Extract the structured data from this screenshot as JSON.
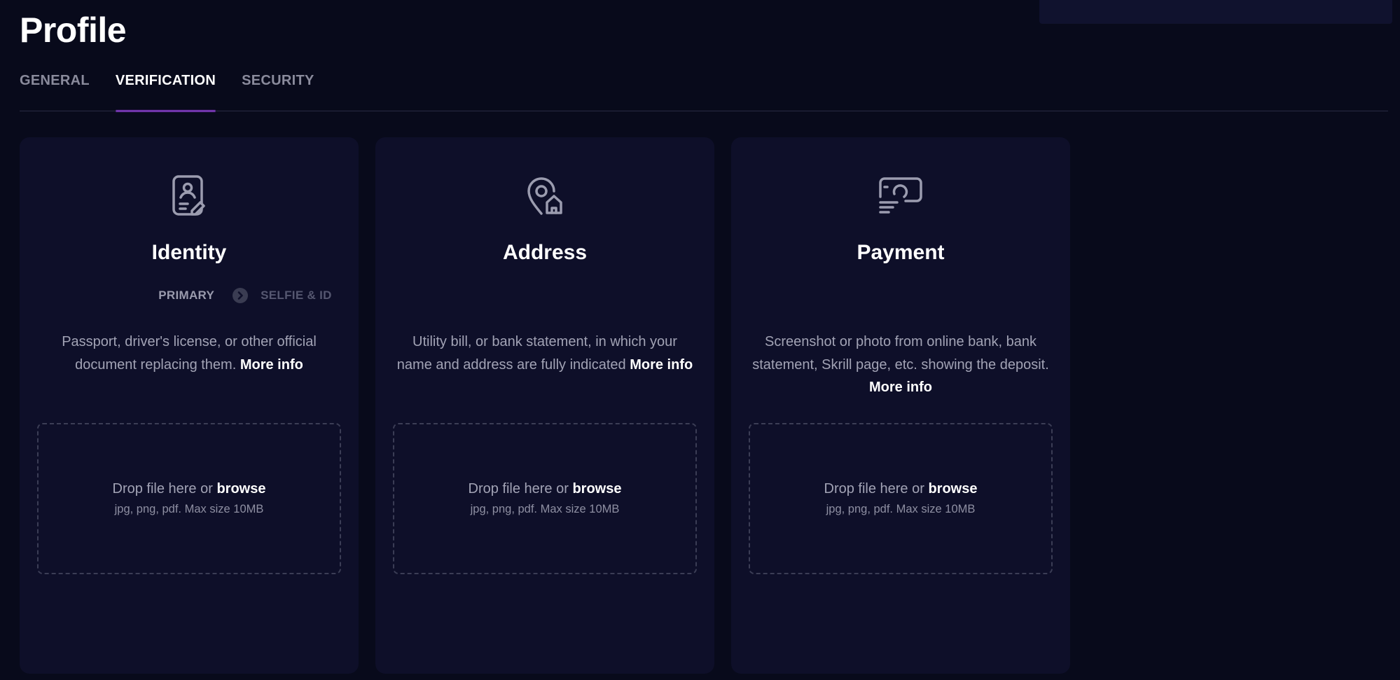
{
  "page": {
    "title": "Profile"
  },
  "tabs": [
    {
      "label": "GENERAL",
      "active": false
    },
    {
      "label": "VERIFICATION",
      "active": true
    },
    {
      "label": "SECURITY",
      "active": false
    }
  ],
  "colors": {
    "background": "#080a1b",
    "card": "#0e0f29",
    "accent": "#a03cf0",
    "muted_text": "#a2a3b5"
  },
  "cards": [
    {
      "icon": "id-document-icon",
      "title": "Identity",
      "steps": {
        "primary": "PRIMARY",
        "secondary": "SELFIE & ID"
      },
      "description": "Passport, driver's license, or other official document replacing them.",
      "more_info": "More info",
      "dropzone": {
        "text": "Drop file here or",
        "browse": "browse",
        "hint": "jpg, png, pdf. Max size 10MB"
      }
    },
    {
      "icon": "location-home-icon",
      "title": "Address",
      "description": "Utility bill, or bank statement, in which your name and address are fully indicated",
      "more_info": "More info",
      "dropzone": {
        "text": "Drop file here or",
        "browse": "browse",
        "hint": "jpg, png, pdf. Max size 10MB"
      }
    },
    {
      "icon": "payment-card-icon",
      "title": "Payment",
      "description": "Screenshot or photo from online bank, bank statement, Skrill page, etc. showing the deposit.",
      "more_info": "More info",
      "dropzone": {
        "text": "Drop file here or",
        "browse": "browse",
        "hint": "jpg, png, pdf. Max size 10MB"
      }
    }
  ]
}
